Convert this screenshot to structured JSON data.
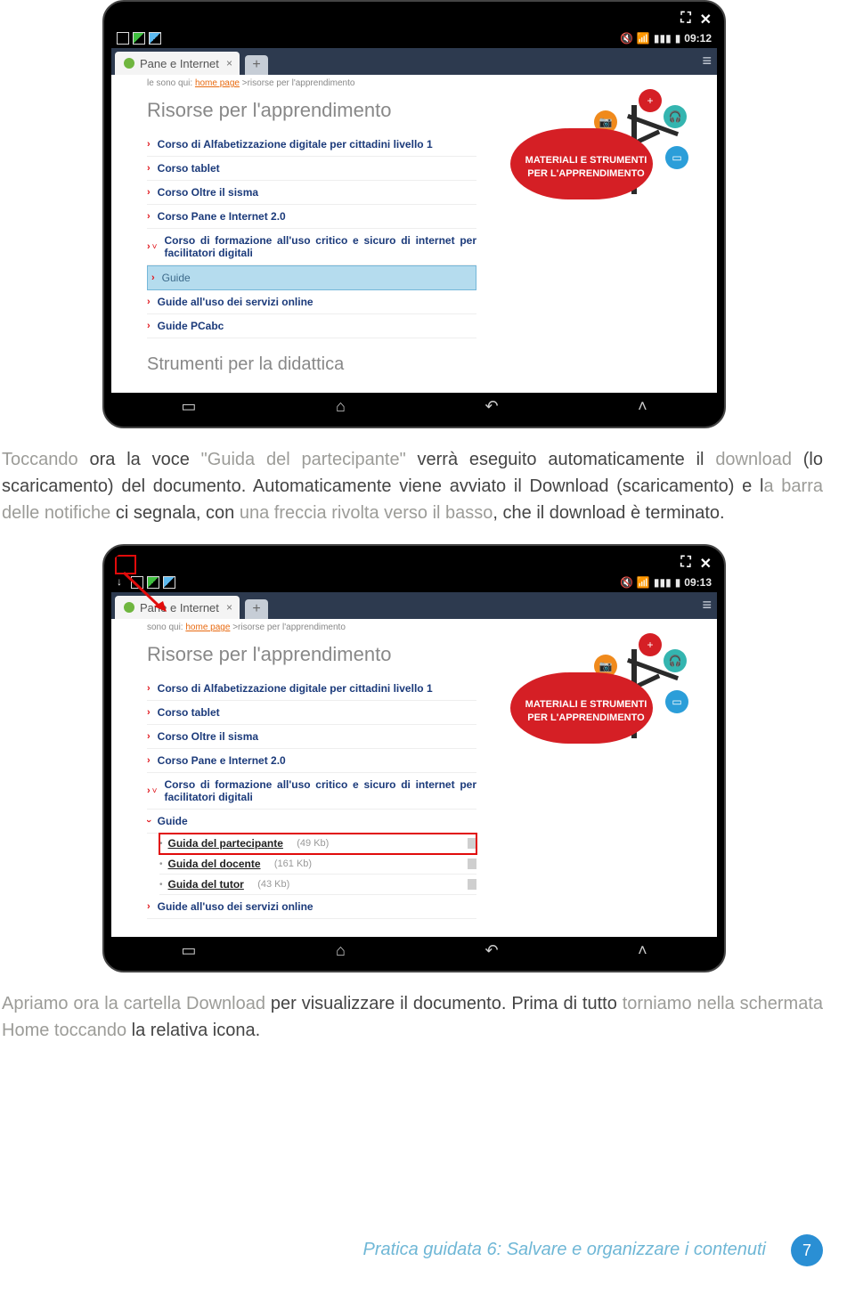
{
  "screenshots": {
    "s1": {
      "winctrl": {
        "expand": "⛶",
        "close": "✕"
      },
      "status": {
        "time": "09:12",
        "mute": "🔇",
        "wifi": "📶",
        "signal": "▮▮▮",
        "batt": "▮"
      },
      "tab_name": "Pane e Internet",
      "tab_close": "×",
      "tab_new": "+",
      "hamburger": "≡",
      "breadcrumb_pre": "le sono qui: ",
      "breadcrumb_link": "home page",
      "breadcrumb_post": " >risorse per l'apprendimento",
      "heading": "Risorse per l'apprendimento",
      "items": [
        "Corso di Alfabetizzazione digitale per cittadini livello 1",
        "Corso tablet",
        "Corso Oltre il sisma",
        "Corso Pane e Internet 2.0",
        "Corso di formazione all'uso critico e sicuro di internet per facilitatori digitali",
        "Guide",
        "Guide all'uso dei servizi online",
        "Guide PCabc"
      ],
      "selected_index": 5,
      "subheading": "Strumenti per la didattica",
      "promo_line1": "MATERIALI E STRUMENTI",
      "promo_line2": "PER L'",
      "promo_line2b": "APPRENDIMENTO",
      "nav": {
        "recent": "▭",
        "home": "⌂",
        "back": "↶",
        "menu": "˄"
      }
    },
    "s2": {
      "winctrl": {
        "expand": "⛶",
        "close": "✕"
      },
      "status": {
        "time": "09:13",
        "mute": "🔇",
        "wifi": "📶",
        "signal": "▮▮▮",
        "batt": "▮"
      },
      "tab_name": "Pane e Internet",
      "tab_close": "×",
      "tab_new": "+",
      "hamburger": "≡",
      "breadcrumb_pre": "sono qui: ",
      "breadcrumb_link": "home page",
      "breadcrumb_post": " >risorse per l'apprendimento",
      "heading": "Risorse per l'apprendimento",
      "items": [
        "Corso di Alfabetizzazione digitale per cittadini livello 1",
        "Corso tablet",
        "Corso Oltre il sisma",
        "Corso Pane e Internet 2.0",
        "Corso di formazione all'uso critico e sicuro di internet per facilitatori digitali"
      ],
      "guide_label": "Guide",
      "sub_items": [
        {
          "name": "Guida del partecipante",
          "size": "(49 Kb)"
        },
        {
          "name": "Guida del docente",
          "size": "(161 Kb)"
        },
        {
          "name": "Guida del tutor",
          "size": "(43 Kb)"
        }
      ],
      "boxed_sub_index": 0,
      "tail_item": "Guide all'uso dei servizi online",
      "promo_line1": "MATERIALI E STRUMENTI",
      "promo_line2": "PER L'",
      "promo_line2b": "APPRENDIMENTO",
      "nav": {
        "recent": "▭",
        "home": "⌂",
        "back": "↶",
        "menu": "˄"
      }
    }
  },
  "para1_parts": {
    "a": "Toccando",
    "b": " ora la voce ",
    "c": "\"Guida del partecipante\"",
    "d": " verrà eseguito automaticamente il ",
    "e": "download",
    "f": " (lo scaricamento) del documento. Automaticamente viene avviato il Download (scaricamento) e l",
    "g": "a barra delle notifiche",
    "h": " ci segnala, con ",
    "i": "una freccia rivolta verso il basso",
    "j": ", che il download è terminato."
  },
  "para2_parts": {
    "a": "Apriamo ora la cartella Download",
    "b": " per visualizzare il documento. Prima di tutto ",
    "c": "torniamo nella schermata Home toccando",
    "d": " la relativa icona."
  },
  "footer": {
    "text": "Pratica guidata 6: Salvare e organizzare i contenuti",
    "page": "7"
  }
}
